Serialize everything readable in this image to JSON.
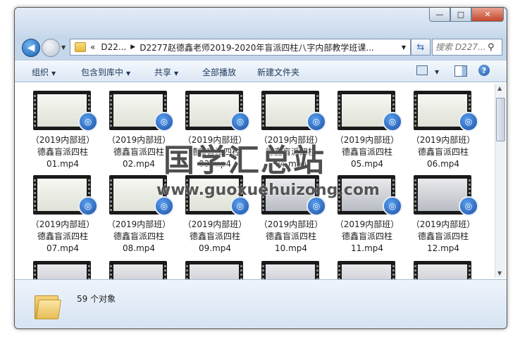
{
  "window": {
    "controls": {
      "minimize": "—",
      "maximize": "□",
      "close": "✕"
    }
  },
  "nav": {
    "back_icon": "arrow-left-icon",
    "forward_icon": "arrow-right-icon",
    "breadcrumb": [
      "D22...",
      "D2277赵德鑫老师2019-2020年盲派四柱八字内部教学班课..."
    ],
    "breadcrumb_prefix": "«",
    "search_placeholder": "搜索 D227..."
  },
  "toolbar": {
    "organize": "组织",
    "include_in_library": "包含到库中",
    "share": "共享",
    "play_all": "全部播放",
    "new_folder": "新建文件夹"
  },
  "files": [
    {
      "line1": "（2019内部班）",
      "line2": "德鑫盲派四柱",
      "line3": "01.mp4"
    },
    {
      "line1": "（2019内部班）",
      "line2": "德鑫盲派四柱",
      "line3": "02.mp4"
    },
    {
      "line1": "（2019内部班）",
      "line2": "德鑫盲派四柱",
      "line3": "03.mp4"
    },
    {
      "line1": "（2019内部班）",
      "line2": "德鑫盲派四柱",
      "line3": "04.mp4"
    },
    {
      "line1": "（2019内部班）",
      "line2": "德鑫盲派四柱",
      "line3": "05.mp4"
    },
    {
      "line1": "（2019内部班）",
      "line2": "德鑫盲派四柱",
      "line3": "06.mp4"
    },
    {
      "line1": "（2019内部班）",
      "line2": "德鑫盲派四柱",
      "line3": "07.mp4"
    },
    {
      "line1": "（2019内部班）",
      "line2": "德鑫盲派四柱",
      "line3": "08.mp4"
    },
    {
      "line1": "（2019内部班）",
      "line2": "德鑫盲派四柱",
      "line3": "09.mp4"
    },
    {
      "line1": "（2019内部班）",
      "line2": "德鑫盲派四柱",
      "line3": "10.mp4"
    },
    {
      "line1": "（2019内部班）",
      "line2": "德鑫盲派四柱",
      "line3": "11.mp4"
    },
    {
      "line1": "（2019内部班）",
      "line2": "德鑫盲派四柱",
      "line3": "12.mp4"
    }
  ],
  "status": {
    "item_count": "59 个对象"
  },
  "watermark": {
    "text": "国学汇总站",
    "url": "www.guoxuehuizong.com"
  }
}
